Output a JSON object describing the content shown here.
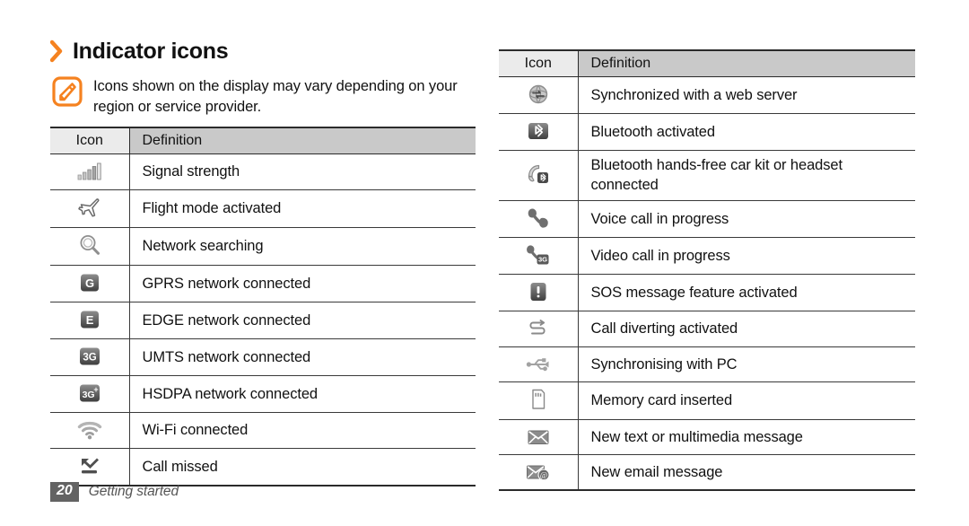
{
  "heading": {
    "chevron_icon": "chevron-right-icon",
    "title": "Indicator icons"
  },
  "note": {
    "icon": "note-pencil-icon",
    "text": "Icons shown on the display may vary depending on your region or service provider."
  },
  "colors": {
    "accent_orange": "#f58220",
    "header_icon_bg": "#ebebeb",
    "header_definition_bg": "#c9c9c9",
    "rule": "#2b2b2b",
    "page_number_bg": "#636363",
    "icon_dark": "#4a4a4a",
    "icon_light": "#a8a8a8"
  },
  "tables": [
    {
      "id": "left-indicator-table",
      "columns": [
        "Icon",
        "Definition"
      ],
      "rows": [
        {
          "icon": "signal-strength-icon",
          "definition": "Signal strength"
        },
        {
          "icon": "flight-mode-icon",
          "definition": "Flight mode activated"
        },
        {
          "icon": "network-searching-icon",
          "definition": "Network searching"
        },
        {
          "icon": "gprs-badge-icon",
          "badge_text": "G",
          "definition": "GPRS network connected"
        },
        {
          "icon": "edge-badge-icon",
          "badge_text": "E",
          "definition": "EDGE network connected"
        },
        {
          "icon": "umts-badge-icon",
          "badge_text": "3G",
          "definition": "UMTS network connected"
        },
        {
          "icon": "hsdpa-badge-icon",
          "badge_text": "3G+",
          "definition": "HSDPA network connected"
        },
        {
          "icon": "wifi-icon",
          "definition": "Wi-Fi connected"
        },
        {
          "icon": "call-missed-icon",
          "definition": "Call missed"
        }
      ]
    },
    {
      "id": "right-indicator-table",
      "columns": [
        "Icon",
        "Definition"
      ],
      "rows": [
        {
          "icon": "web-sync-icon",
          "definition": "Synchronized with a web server"
        },
        {
          "icon": "bluetooth-badge-icon",
          "definition": "Bluetooth activated"
        },
        {
          "icon": "bluetooth-headset-icon",
          "definition": "Bluetooth hands-free car kit or headset connected"
        },
        {
          "icon": "voice-call-icon",
          "definition": "Voice call in progress"
        },
        {
          "icon": "video-call-icon",
          "definition": "Video call in progress"
        },
        {
          "icon": "sos-badge-icon",
          "definition": "SOS message feature activated"
        },
        {
          "icon": "call-diverting-icon",
          "definition": "Call diverting activated"
        },
        {
          "icon": "usb-sync-icon",
          "definition": "Synchronising with PC"
        },
        {
          "icon": "memory-card-icon",
          "definition": "Memory card inserted"
        },
        {
          "icon": "new-message-icon",
          "definition": "New text or multimedia message"
        },
        {
          "icon": "new-email-icon",
          "definition": "New email message"
        }
      ]
    }
  ],
  "footer": {
    "page_number": "20",
    "section": "Getting started"
  }
}
